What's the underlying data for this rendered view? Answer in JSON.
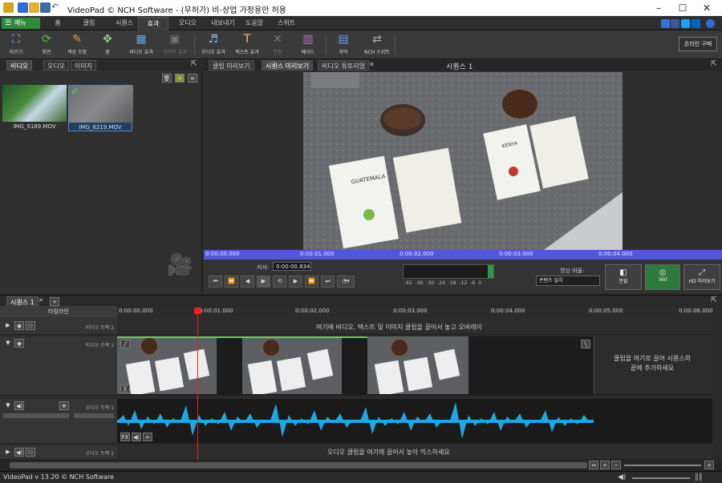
{
  "titlebar": {
    "title": "VideoPad © NCH Software - (무허가) 비-상업 가정용만 허용"
  },
  "menu": {
    "button": "메뉴",
    "tabs": [
      "홈",
      "클립",
      "시퀀스",
      "효과",
      "오디오",
      "내보내기",
      "도움말",
      "스위트"
    ],
    "active": "효과"
  },
  "toolbar": {
    "tools": [
      "자르기",
      "회전",
      "색상 조정",
      "줌",
      "비디오 효과",
      "이미지 효과",
      "오디오 효과",
      "텍스트 효과",
      "전환",
      "페이드",
      "자막",
      "NCH 스위트"
    ],
    "buy": "온라인 구매"
  },
  "bin": {
    "tabs": [
      "비디오",
      "오디오",
      "이미지"
    ],
    "clips": [
      "IMG_5189.MOV",
      "IMG_6219.MOV"
    ]
  },
  "preview": {
    "tabs": [
      "클립 미리보기",
      "시퀀스 미리보기",
      "비디오 튜토리얼"
    ],
    "sequence_title": "시퀀스 1",
    "ruler": [
      "0:00:00.000",
      "0:00:01.000",
      "0:00:02.000",
      "0:00:03.000",
      "0:00:04.000"
    ],
    "cursor_label": "커서:",
    "cursor_value": "0:00:00.834",
    "meter_scale": "-42 -36 -30 -24 -18 -12 -6 0",
    "ratio_label": "영상 비율:",
    "ratio_value": "콘텐츠 일치",
    "split": "분할",
    "vr": "360",
    "hd": "HD 미리보기"
  },
  "sequence": {
    "tab": "시퀀스 1",
    "timeline_label": "타임라인",
    "ticks": [
      "0:00:00.000",
      "0:00:01.000",
      "0:00:02.000",
      "0:00:03.000",
      "0:00:04.000",
      "0:00:05.000",
      "0:00:06.000"
    ],
    "tracks": {
      "video2": "비디오 트랙 2",
      "video1": "비디오 트랙 1",
      "audio1": "오디오 트랙 1",
      "audio2": "오디오 트랙 2"
    },
    "hint_overlay": "여기에 비디오, 텍스트 및 이미지 클립을 끌어서 놓고 오버레이",
    "hint_drop": "클립을 여기로 끌어 시퀀스의 끝에 추가하세요",
    "hint_audio": "오디오 클립을 여기에 끌어서 놓아 믹스하세요"
  },
  "status": {
    "text": "VideoPad v 13.20 © NCH Software"
  },
  "video_cards": {
    "left": "GUATEMALA",
    "right": "KENYA"
  }
}
